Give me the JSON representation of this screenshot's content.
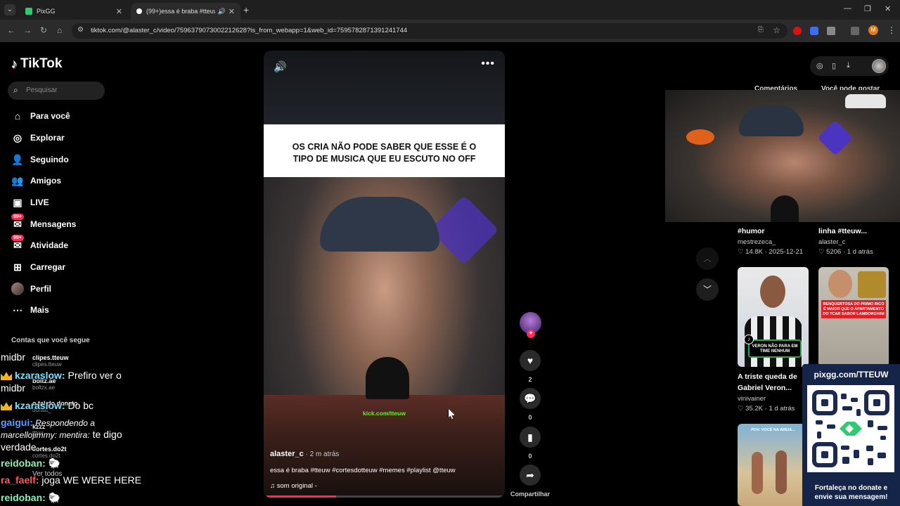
{
  "browser": {
    "tabs": [
      {
        "title": "PixGG",
        "favicon_color": "#2ecc71"
      },
      {
        "title": "(99+)essa é braba #tteuw #"
      }
    ],
    "url": "tiktok.com/@alaster_c/video/7596379073002212628?is_from_webapp=1&web_id=7595782871391241744",
    "profile_letter": "M",
    "accent": "#fe2c55"
  },
  "sidebar": {
    "logo": "TikTok",
    "search_placeholder": "Pesquisar",
    "items": [
      {
        "label": "Para você",
        "icon": "home-icon"
      },
      {
        "label": "Explorar",
        "icon": "compass-icon"
      },
      {
        "label": "Seguindo",
        "icon": "following-icon"
      },
      {
        "label": "Amigos",
        "icon": "friends-icon"
      },
      {
        "label": "LIVE",
        "icon": "live-icon"
      },
      {
        "label": "Mensagens",
        "icon": "messages-icon",
        "badge": "99+"
      },
      {
        "label": "Atividade",
        "icon": "activity-icon",
        "badge": "99+"
      },
      {
        "label": "Carregar",
        "icon": "upload-icon"
      },
      {
        "label": "Perfil",
        "icon": "avatar"
      },
      {
        "label": "Mais",
        "icon": "more-icon"
      }
    ],
    "following_header": "Contas que você segue",
    "following": [
      {
        "name": "clipes.tteuw",
        "handle": "clipes.tteuw"
      },
      {
        "name": "boltz.ae",
        "handle": "boltzx.ae"
      },
      {
        "name": "o tal do donato",
        "handle": "donatt_"
      },
      {
        "name": "kzzz",
        "handle": "kzzz"
      },
      {
        "name": "cortes.do2t",
        "handle": "cortes.do2t"
      }
    ],
    "see_all": "Ver todos"
  },
  "chat": [
    {
      "user": "",
      "text": "midbr"
    },
    {
      "user": "kzaraslow:",
      "text": " Prefiro ver o",
      "crown": true,
      "color": "#7ee0ff"
    },
    {
      "user": "",
      "text": "midbr"
    },
    {
      "user": "kzaraslow:",
      "text": " Do bc",
      "crown": true,
      "color": "#7ee0ff"
    },
    {
      "user": "gaigui:",
      "text": " Respondendo a",
      "color": "#5c9cff",
      "italic": true
    },
    {
      "user": "",
      "text": "marcellojimmy: mentira:",
      "italic": true,
      "tail": " te digo"
    },
    {
      "user": "",
      "text": "verdade"
    },
    {
      "user": "reidoban:",
      "text": " 🐑",
      "color": "#8ef0b5"
    },
    {
      "user": "ra_faelf:",
      "text": " joga WE WERE HERE",
      "color": "#ff5a5a"
    },
    {
      "user": "reidoban:",
      "text": " 🐑",
      "color": "#8ef0b5"
    }
  ],
  "video": {
    "caption_line1": "OS CRIA NÃO PODE SABER QUE ESSE É O",
    "caption_line2": "TIPO DE MUSICA QUE EU ESCUTO NO OFF",
    "kick_text": "kick.com/tteuw",
    "author": "alaster_c",
    "time": " · 2 m atrás",
    "description": "essa é braba #tteuw #cortesdotteuw #memes #playlist @tteuw",
    "sound": "som original -",
    "progress": 0.3
  },
  "actions": {
    "likes": "2",
    "comments": "0",
    "saves": "0",
    "share_label": "Compartilhar"
  },
  "right_panel": {
    "tab_comments": "Comentários",
    "tab_suggested": "Você pode gostar",
    "suggested": [
      {
        "title": "#humor",
        "author": "mestrezeca_",
        "views": "♡ 14.8K",
        "date": "2025-12-21"
      },
      {
        "title": "linha #tteuw...",
        "author": "alaster_c",
        "views": "♡ 5206",
        "date": "1 d atrás"
      },
      {
        "title": "A triste queda de",
        "title2": "Gabriel Veron...",
        "author": "vinivainer",
        "views": "♡ 35.2K",
        "date": "1 d atrás",
        "thumb_text": "VERON NÃO PARA EM TIME NENHUM"
      },
      {
        "thumb_text": "BENQUERTOSA DO PRIMO RICO É MAIOR QUE O APARTAMENTO DO TCAR SABOR LAMBORGHINI"
      },
      {
        "thumb_text": "POV: VOCÊ NA AREIA..."
      }
    ]
  },
  "qr_panel": {
    "url": "pixgg.com/TTEUW",
    "cta_line1": "Fortaleça no donate e",
    "cta_line2": "envie sua mensagem!"
  }
}
